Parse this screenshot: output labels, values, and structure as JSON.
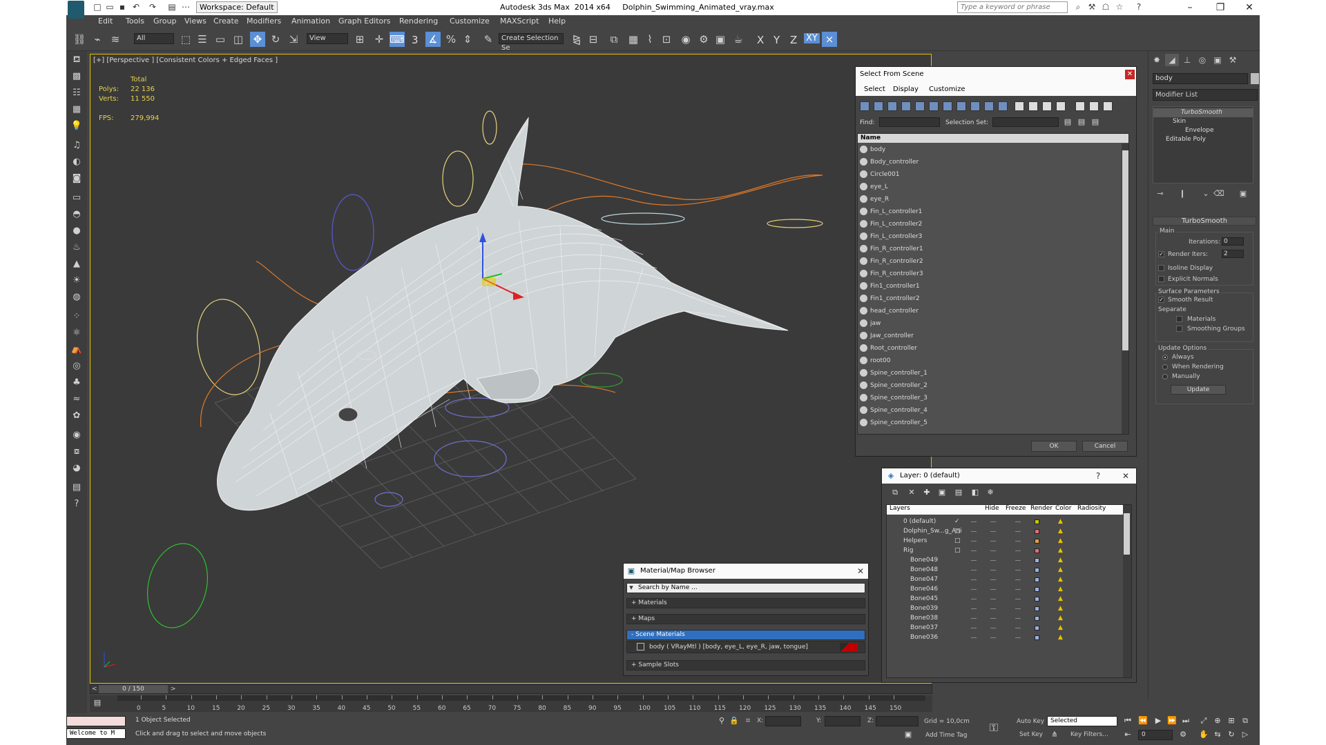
{
  "window": {
    "title": "Autodesk 3ds Max  2014 x64     Dolphin_Swimming_Animated_vray.max",
    "workspace": "Workspace: Default",
    "search_placeholder": "Type a keyword or phrase"
  },
  "menu": [
    "Edit",
    "Tools",
    "Group",
    "Views",
    "Create",
    "Modifiers",
    "Animation",
    "Graph Editors",
    "Rendering",
    "Customize",
    "MAXScript",
    "Help"
  ],
  "toolbar": {
    "filter": "All",
    "coord": "View",
    "selection_set": "Create Selection Se",
    "snap_label": "3",
    "axes": [
      "X",
      "Y",
      "Z",
      "XY"
    ],
    "axes_active": "XY",
    "icons": [
      "link-icon",
      "unlink-icon",
      "bind-space-warp-icon",
      "select-object-icon",
      "select-by-name-icon",
      "rect-region-icon",
      "window-crossing-icon",
      "select-move-icon",
      "select-rotate-icon",
      "select-scale-icon",
      "pivot-icon",
      "manipulate-icon",
      "snaps-icon",
      "angle-snap-icon",
      "percent-snap-icon",
      "spinner-snap-icon",
      "edit-named-sets-icon",
      "mirror-icon",
      "align-icon",
      "layer-explorer-icon",
      "toggle-ribbon-icon",
      "curve-editor-icon",
      "schematic-view-icon",
      "material-editor-icon",
      "render-setup-icon",
      "rendered-frame-icon",
      "render-icon"
    ]
  },
  "viewport": {
    "label": "[+] [Perspective ] [Consistent Colors + Edged Faces ]",
    "stats": {
      "header": "Total",
      "polys_label": "Polys:",
      "polys": "22 136",
      "verts_label": "Verts:",
      "verts": "11 550",
      "fps_label": "FPS:",
      "fps": "279,994"
    }
  },
  "select_from_scene": {
    "title": "Select From Scene",
    "menu": [
      "Select",
      "Display",
      "Customize"
    ],
    "find_label": "Find:",
    "selection_set_label": "Selection Set:",
    "column": "Name",
    "items": [
      "body",
      "Body_controller",
      "Circle001",
      "eye_L",
      "eye_R",
      "Fin_L_controller1",
      "Fin_L_controller2",
      "Fin_L_controller3",
      "Fin_R_controller1",
      "Fin_R_controller2",
      "Fin_R_controller3",
      "Fin1_controller1",
      "Fin1_controller2",
      "head_controller",
      "jaw",
      "Jaw_controller",
      "Root_controller",
      "root00",
      "Spine_controller_1",
      "Spine_controller_2",
      "Spine_controller_3",
      "Spine_controller_4",
      "Spine_controller_5"
    ],
    "ok": "OK",
    "cancel": "Cancel"
  },
  "layers": {
    "title": "Layer: 0 (default)",
    "help": "?",
    "columns": [
      "Layers",
      "Hide",
      "Freeze",
      "Render",
      "Color",
      "Radiosity"
    ],
    "rows": [
      {
        "name": "0 (default)",
        "indent": 0,
        "color": "#c8c800",
        "check": "✓"
      },
      {
        "name": "Dolphin_Sw...g_Ani",
        "indent": 0,
        "color": "#e07070",
        "check": "□"
      },
      {
        "name": "Helpers",
        "indent": 0,
        "color": "#e0a040",
        "check": "□"
      },
      {
        "name": "Rig",
        "indent": 0,
        "color": "#e07070",
        "check": "□"
      },
      {
        "name": "Bone049",
        "indent": 1,
        "color": "#9ab0e0",
        "check": ""
      },
      {
        "name": "Bone048",
        "indent": 1,
        "color": "#9ab0e0",
        "check": ""
      },
      {
        "name": "Bone047",
        "indent": 1,
        "color": "#9ab0e0",
        "check": ""
      },
      {
        "name": "Bone046",
        "indent": 1,
        "color": "#9ab0e0",
        "check": ""
      },
      {
        "name": "Bone045",
        "indent": 1,
        "color": "#9ab0e0",
        "check": ""
      },
      {
        "name": "Bone039",
        "indent": 1,
        "color": "#9ab0e0",
        "check": ""
      },
      {
        "name": "Bone038",
        "indent": 1,
        "color": "#9ab0e0",
        "check": ""
      },
      {
        "name": "Bone037",
        "indent": 1,
        "color": "#9ab0e0",
        "check": ""
      },
      {
        "name": "Bone036",
        "indent": 1,
        "color": "#9ab0e0",
        "check": ""
      }
    ]
  },
  "material_browser": {
    "title": "Material/Map Browser",
    "search": "Search by Name ...",
    "groups": [
      "+ Materials",
      "+ Maps",
      "- Scene Materials"
    ],
    "item": "body  ( VRayMtl ) [body, eye_L, eye_R, jaw, tongue]",
    "sample_slots": "+ Sample Slots"
  },
  "command_panel": {
    "object_name": "body",
    "modifier_list": "Modifier List",
    "stack": [
      "TurboSmooth",
      "Skin",
      "Envelope",
      "Editable Poly"
    ],
    "rollout": "TurboSmooth",
    "main": "Main",
    "iterations_label": "Iterations:",
    "iterations": "0",
    "render_iters_label": "Render Iters:",
    "render_iters": "2",
    "isoline": "Isoline Display",
    "explicit_normals": "Explicit Normals",
    "surface_params": "Surface Parameters",
    "smooth_result": "Smooth Result",
    "separate": "Separate",
    "materials": "Materials",
    "smoothing_groups": "Smoothing Groups",
    "update_options": "Update Options",
    "always": "Always",
    "when_rendering": "When Rendering",
    "manually": "Manually",
    "update": "Update"
  },
  "timeline": {
    "frame": "0 / 150",
    "ticks": [
      "0",
      "5",
      "10",
      "15",
      "20",
      "25",
      "30",
      "35",
      "40",
      "45",
      "50",
      "55",
      "60",
      "65",
      "70",
      "75",
      "80",
      "85",
      "90",
      "95",
      "100",
      "105",
      "110",
      "115",
      "120",
      "125",
      "130",
      "135",
      "140",
      "145",
      "150"
    ]
  },
  "status": {
    "selected": "1 Object Selected",
    "prompt": "Click and drag to select and move objects",
    "maxscript": "Welcome to M",
    "x_label": "X:",
    "y_label": "Y:",
    "z_label": "Z:",
    "grid": "Grid = 10,0cm",
    "auto_key": "Auto Key",
    "set_key": "Set Key",
    "key_mode": "Selected",
    "key_filters": "Key Filters...",
    "add_time_tag": "Add Time Tag",
    "frame_field": "0"
  }
}
